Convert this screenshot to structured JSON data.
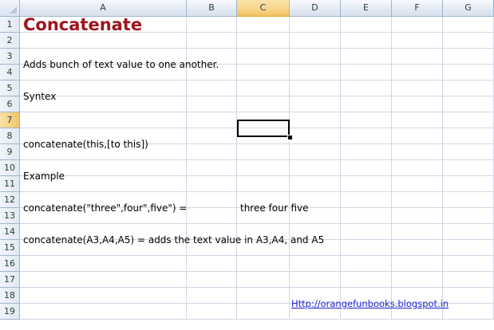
{
  "columns": [
    "A",
    "B",
    "C",
    "D",
    "E",
    "F",
    "G"
  ],
  "selected_column": "C",
  "selected_row": 7,
  "rows": [
    "1",
    "2",
    "3",
    "4",
    "5",
    "6",
    "7",
    "8",
    "9",
    "10",
    "11",
    "12",
    "13",
    "14",
    "15",
    "16",
    "17",
    "18",
    "19"
  ],
  "cells": {
    "title": "Concatenate",
    "description": "Adds bunch of text value to one another.",
    "syntax_heading": "Syntex",
    "syntax": "concatenate(this,[to this])",
    "example_heading": "Example",
    "example_formula": "concatenate(\"three\",four\",five\")  =",
    "example_result": "three four five",
    "example2": "concatenate(A3,A4,A5) = adds the text value in A3,A4, and A5",
    "link": "Http://orangefunbooks.blogspot.in"
  }
}
